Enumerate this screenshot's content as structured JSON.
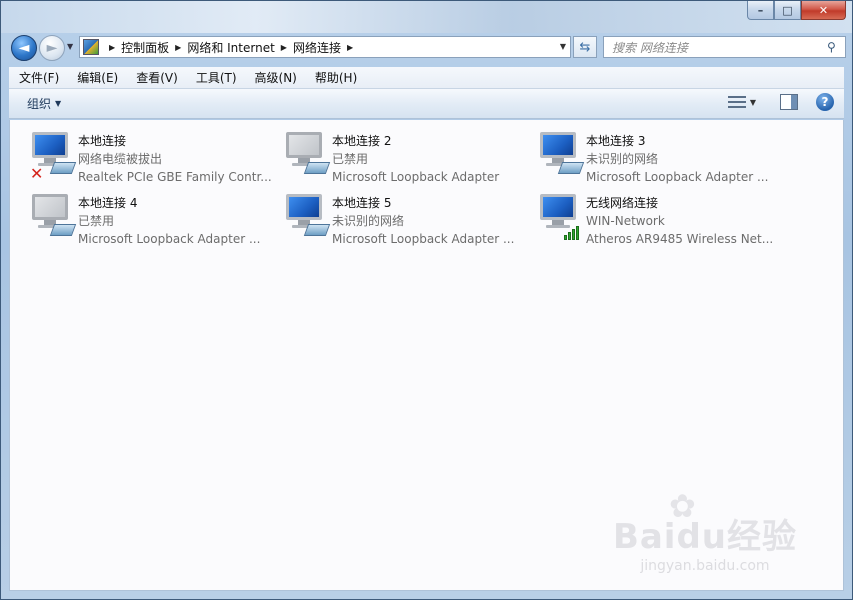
{
  "window": {
    "caption_buttons": [
      "–",
      "□",
      "✕"
    ]
  },
  "nav": {
    "back": "◄",
    "forward": "►",
    "breadcrumbs": [
      "控制面板",
      "网络和 Internet",
      "网络连接"
    ],
    "search_placeholder": "搜索 网络连接"
  },
  "menu": [
    "文件(F)",
    "编辑(E)",
    "查看(V)",
    "工具(T)",
    "高级(N)",
    "帮助(H)"
  ],
  "toolbar": {
    "organize_label": "组织"
  },
  "connections": [
    {
      "name": "本地连接",
      "status": "网络电缆被拔出",
      "adapter": "Realtek PCIe GBE Family Contr...",
      "icon": "wired-disconnected"
    },
    {
      "name": "本地连接 2",
      "status": "已禁用",
      "adapter": "Microsoft Loopback Adapter",
      "icon": "wired-disabled"
    },
    {
      "name": "本地连接 3",
      "status": "未识别的网络",
      "adapter": "Microsoft Loopback Adapter ...",
      "icon": "wired"
    },
    {
      "name": "本地连接 4",
      "status": "已禁用",
      "adapter": "Microsoft Loopback Adapter ...",
      "icon": "wired-disabled"
    },
    {
      "name": "本地连接 5",
      "status": "未识别的网络",
      "adapter": "Microsoft Loopback Adapter ...",
      "icon": "wired"
    },
    {
      "name": "无线网络连接",
      "status": "WIN-Network",
      "adapter": "Atheros AR9485 Wireless Net...",
      "icon": "wireless"
    }
  ],
  "watermark": {
    "brand": "Baidu经验",
    "url": "jingyan.baidu.com"
  },
  "colors": {
    "accent": "#2e77c9",
    "disconnected": "#d4231b",
    "signal": "#2fa82f"
  }
}
